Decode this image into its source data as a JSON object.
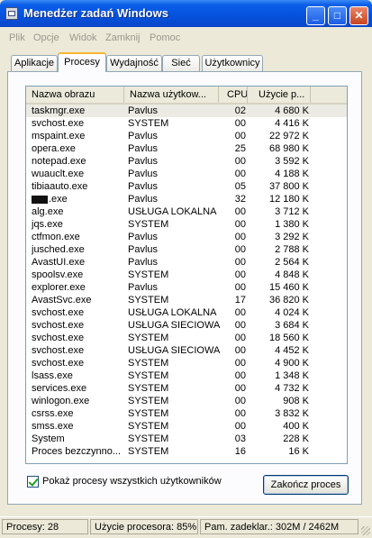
{
  "window": {
    "title": "Menedżer zadań Windows"
  },
  "titlebar": {
    "minimize": "_",
    "maximize": "□",
    "close": "✕"
  },
  "menu": [
    "Plik",
    "Opcje",
    "Widok",
    "Zamknij",
    "Pomoc"
  ],
  "tabs": [
    {
      "label": "Aplikacje",
      "active": false
    },
    {
      "label": "Procesy",
      "active": true
    },
    {
      "label": "Wydajność",
      "active": false
    },
    {
      "label": "Sieć",
      "active": false
    },
    {
      "label": "Użytkownicy",
      "active": false
    }
  ],
  "columns": [
    "Nazwa obrazu",
    "Nazwa użytkow...",
    "CPU",
    "Użycie p..."
  ],
  "processes": [
    {
      "name": "taskmgr.exe",
      "user": "Pavlus",
      "cpu": "02",
      "mem": "4 680 K"
    },
    {
      "name": "svchost.exe",
      "user": "SYSTEM",
      "cpu": "00",
      "mem": "4 416 K"
    },
    {
      "name": "mspaint.exe",
      "user": "Pavlus",
      "cpu": "00",
      "mem": "22 972 K"
    },
    {
      "name": "opera.exe",
      "user": "Pavlus",
      "cpu": "25",
      "mem": "68 980 K"
    },
    {
      "name": "notepad.exe",
      "user": "Pavlus",
      "cpu": "00",
      "mem": "3 592 K"
    },
    {
      "name": "wuauclt.exe",
      "user": "Pavlus",
      "cpu": "00",
      "mem": "4 188 K"
    },
    {
      "name": "tibiaauto.exe",
      "user": "Pavlus",
      "cpu": "05",
      "mem": "37 800 K"
    },
    {
      "name": ".exe",
      "user": "Pavlus",
      "cpu": "32",
      "mem": "12 180 K",
      "redacted": true
    },
    {
      "name": "alg.exe",
      "user": "USŁUGA LOKALNA",
      "cpu": "00",
      "mem": "3 712 K"
    },
    {
      "name": "jqs.exe",
      "user": "SYSTEM",
      "cpu": "00",
      "mem": "1 380 K"
    },
    {
      "name": "ctfmon.exe",
      "user": "Pavlus",
      "cpu": "00",
      "mem": "3 292 K"
    },
    {
      "name": "jusched.exe",
      "user": "Pavlus",
      "cpu": "00",
      "mem": "2 788 K"
    },
    {
      "name": "AvastUI.exe",
      "user": "Pavlus",
      "cpu": "00",
      "mem": "2 564 K"
    },
    {
      "name": "spoolsv.exe",
      "user": "SYSTEM",
      "cpu": "00",
      "mem": "4 848 K"
    },
    {
      "name": "explorer.exe",
      "user": "Pavlus",
      "cpu": "00",
      "mem": "15 460 K"
    },
    {
      "name": "AvastSvc.exe",
      "user": "SYSTEM",
      "cpu": "17",
      "mem": "36 820 K"
    },
    {
      "name": "svchost.exe",
      "user": "USŁUGA LOKALNA",
      "cpu": "00",
      "mem": "4 024 K"
    },
    {
      "name": "svchost.exe",
      "user": "USŁUGA SIECIOWA",
      "cpu": "00",
      "mem": "3 684 K"
    },
    {
      "name": "svchost.exe",
      "user": "SYSTEM",
      "cpu": "00",
      "mem": "18 560 K"
    },
    {
      "name": "svchost.exe",
      "user": "USŁUGA SIECIOWA",
      "cpu": "00",
      "mem": "4 452 K"
    },
    {
      "name": "svchost.exe",
      "user": "SYSTEM",
      "cpu": "00",
      "mem": "4 900 K"
    },
    {
      "name": "lsass.exe",
      "user": "SYSTEM",
      "cpu": "00",
      "mem": "1 348 K"
    },
    {
      "name": "services.exe",
      "user": "SYSTEM",
      "cpu": "00",
      "mem": "4 732 K"
    },
    {
      "name": "winlogon.exe",
      "user": "SYSTEM",
      "cpu": "00",
      "mem": "908 K"
    },
    {
      "name": "csrss.exe",
      "user": "SYSTEM",
      "cpu": "00",
      "mem": "3 832 K"
    },
    {
      "name": "smss.exe",
      "user": "SYSTEM",
      "cpu": "00",
      "mem": "400 K"
    },
    {
      "name": "System",
      "user": "SYSTEM",
      "cpu": "03",
      "mem": "228 K"
    },
    {
      "name": "Proces bezczynno...",
      "user": "SYSTEM",
      "cpu": "16",
      "mem": "16 K"
    }
  ],
  "show_all_users": {
    "label": "Pokaż procesy wszystkich użytkowników",
    "checked": true
  },
  "end_process_label": "Zakończ proces",
  "status": {
    "processes": "Procesy: 28",
    "cpu": "Użycie procesora: 85%",
    "commit": "Pam. zadeklar.: 302M / 2462M"
  }
}
